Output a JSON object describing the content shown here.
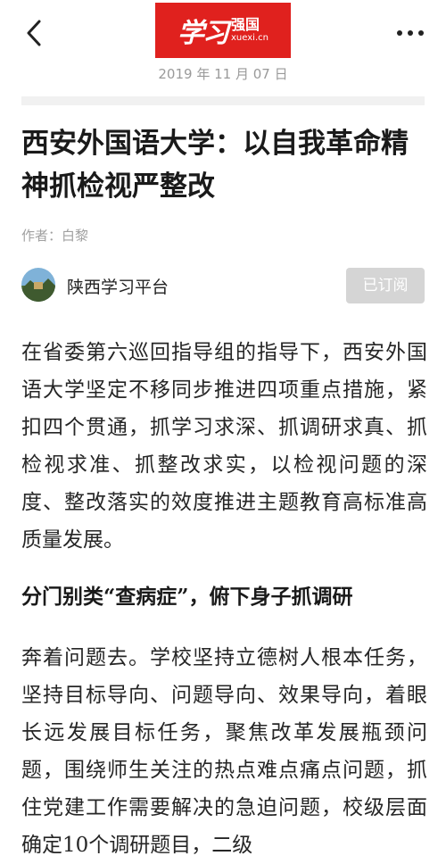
{
  "header": {
    "back_icon": "chevron-left-icon",
    "logo": {
      "brush_text": "学习",
      "cn": "强国",
      "url": "xuexi.cn",
      "color": "#e0211e"
    },
    "more_icon": "more-dots-icon",
    "date": "2019 年 11 月 07 日"
  },
  "article": {
    "title": "西安外国语大学：以自我革命精神抓检视严整改",
    "author": "作者：白黎",
    "source": {
      "name": "陕西学习平台",
      "subscribe_label": "已订阅"
    },
    "paragraph1": "在省委第六巡回指导组的指导下，西安外国语大学坚定不移同步推进四项重点措施，紧扣四个贯通，抓学习求深、抓调研求真、抓检视求准、抓整改求实，以检视问题的深度、整改落实的效度推进主题教育高标准高质量发展。",
    "heading1": "分门别类“查病症”，俯下身子抓调研",
    "paragraph2": "奔着问题去。学校坚持立德树人根本任务，坚持目标导向、问题导向、效果导向，着眼长远发展目标任务，聚焦改革发展瓶颈问题，围绕师生关注的热点难点痛点问题，抓住党建工作需要解决的急迫问题，校级层面确定10个调研题目，二级"
  }
}
